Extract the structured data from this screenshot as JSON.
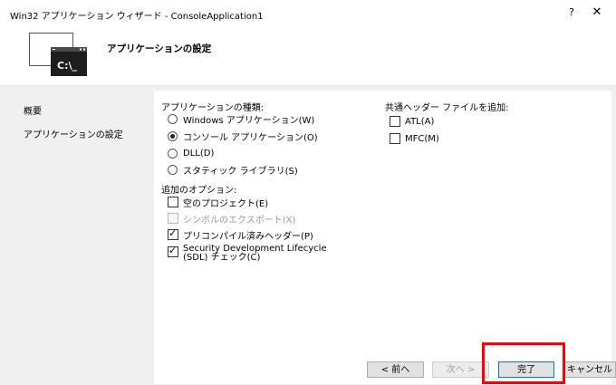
{
  "window": {
    "title": "Win32 アプリケーション ウィザード - ConsoleApplication1",
    "help_label": "?",
    "close_label": "✕"
  },
  "header": {
    "heading": "アプリケーションの設定",
    "icon_text": "C:\\_"
  },
  "nav": {
    "items": [
      {
        "label": "概要"
      },
      {
        "label": "アプリケーションの設定"
      }
    ]
  },
  "app_type": {
    "label": "アプリケーションの種類:",
    "options": [
      {
        "label": "Windows アプリケーション(W)",
        "checked": false
      },
      {
        "label": "コンソール アプリケーション(O)",
        "checked": true
      },
      {
        "label": "DLL(D)",
        "checked": false
      },
      {
        "label": "スタティック ライブラリ(S)",
        "checked": false
      }
    ]
  },
  "extra_options": {
    "label": "追加のオプション:",
    "options": [
      {
        "label": "空のプロジェクト(E)",
        "checked": false,
        "enabled": true
      },
      {
        "label": "シンボルのエクスポート(X)",
        "checked": false,
        "enabled": false
      },
      {
        "label": "プリコンパイル済みヘッダー(P)",
        "checked": true,
        "enabled": true
      },
      {
        "label": "Security Development Lifecycle (SDL) チェック(C)",
        "checked": true,
        "enabled": true
      }
    ]
  },
  "common_headers": {
    "label": "共通ヘッダー ファイルを追加:",
    "options": [
      {
        "label": "ATL(A)",
        "checked": false
      },
      {
        "label": "MFC(M)",
        "checked": false
      }
    ]
  },
  "buttons": {
    "back": "< 前へ",
    "next": "次へ >",
    "finish": "完了",
    "cancel": "キャンセル"
  },
  "colors": {
    "highlight": "#ff0000",
    "focus_border": "#0078d7"
  }
}
